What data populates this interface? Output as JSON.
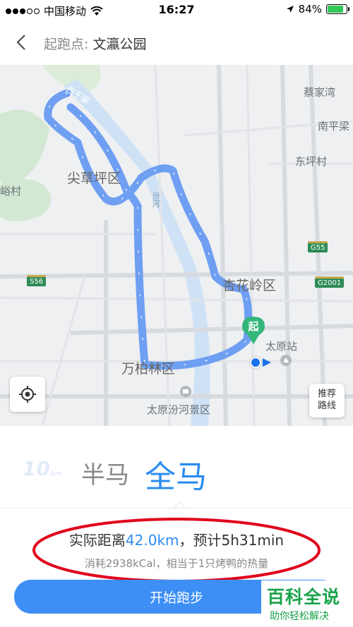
{
  "status_bar": {
    "carrier": "中国移动",
    "time": "16:27",
    "battery": "84%",
    "battery_level": 0.84,
    "signal_bars_filled": 3
  },
  "header": {
    "label": "起跑点:",
    "place": "文瀛公园"
  },
  "map": {
    "places": {
      "caijiawan": "蔡家湾",
      "nanpingliang": "南平梁",
      "dongpingcun": "东坪村",
      "jiancaopingqu": "尖草坪区",
      "yucun": "峪村",
      "xinghualingqu": "杏花岭区",
      "taiyuanzhan": "太原站",
      "wanbailinqu": "万柏林区",
      "fenhe_scenic": "太原汾河景区",
      "fenhe": "汾河",
      "xiaoqiao": "西干渠"
    },
    "highways": {
      "g55": "G55",
      "s56": "S56",
      "g2001": "G2001"
    },
    "start_marker": "起",
    "route_button": "推荐\n路线",
    "route_button_line1": "推荐",
    "route_button_line2": "路线",
    "route_color": "#6f9ff2"
  },
  "distance_tabs": {
    "ten": "10",
    "ten_unit": "km",
    "half": "半马",
    "full": "全马",
    "selected": "全马"
  },
  "summary": {
    "prefix": "实际距离",
    "distance": "42.0km",
    "suffix": "，预计5h31min",
    "calories": "消耗2938kCal，相当于1只烤鸭的热量"
  },
  "start_button": "开始跑步",
  "watermark": {
    "title": "百科全说",
    "subtitle": "助你轻松解决"
  },
  "colors": {
    "accent": "#2b8cf0",
    "button": "#3d8ff5",
    "annotation": "#e0001b"
  }
}
